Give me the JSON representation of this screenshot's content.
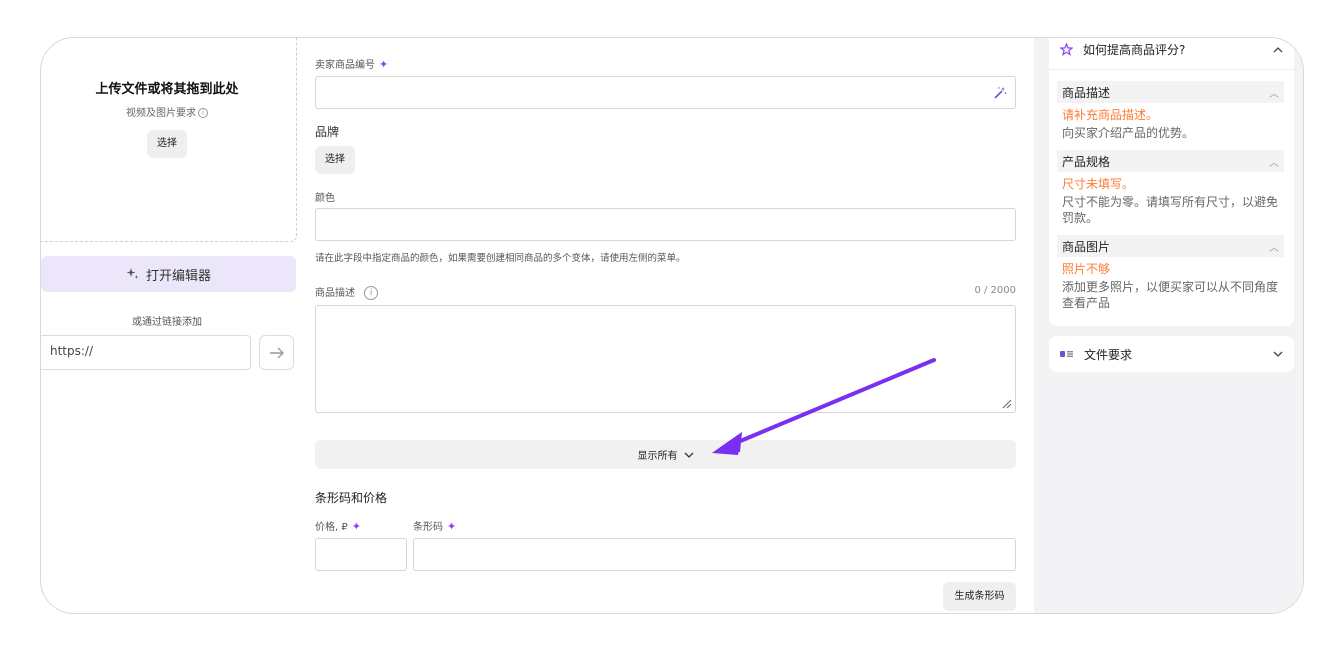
{
  "upload": {
    "title": "上传文件或将其拖到此处",
    "subtitle": "视频及图片要求",
    "select_label": "选择"
  },
  "editor": {
    "label": "打开编辑器"
  },
  "link": {
    "label": "或通过链接添加",
    "placeholder": "https://"
  },
  "form": {
    "seller_sku_label": "卖家商品编号",
    "brand_label": "品牌",
    "brand_select": "选择",
    "color_label": "颜色",
    "color_help": "请在此字段中指定商品的颜色，如果需要创建相同商品的多个变体，请使用左侧的菜单。",
    "description_label": "商品描述",
    "description_counter": "0 / 2000",
    "show_all": "显示所有",
    "barcode_section": "条形码和价格",
    "price_label": "价格, ₽",
    "barcode_label": "条形码",
    "generate_barcode": "生成条形码"
  },
  "rating_panel": {
    "title": "如何提高商品评分?",
    "sections": [
      {
        "title": "商品描述",
        "warning": "请补充商品描述。",
        "desc": "向买家介绍产品的优势。"
      },
      {
        "title": "产品规格",
        "warning": "尺寸未填写。",
        "desc": "尺寸不能为零。请填写所有尺寸，以避免罚款。"
      },
      {
        "title": "商品图片",
        "warning": "照片不够",
        "desc": "添加更多照片，以便买家可以从不同角度查看产品"
      }
    ]
  },
  "file_requirements": {
    "title": "文件要求"
  },
  "colors": {
    "accent_purple": "#8a3ffc",
    "warning_orange": "#ff7a33",
    "editor_button_bg": "#ece6fb",
    "annotation_arrow": "#7b2ff0"
  },
  "icons": [
    "info-icon",
    "sparkle-icon",
    "magic-wand-icon",
    "arrow-right-icon",
    "chevron-down-icon",
    "chevron-up-icon",
    "star-icon",
    "file-requirements-icon",
    "resize-handle-icon"
  ]
}
